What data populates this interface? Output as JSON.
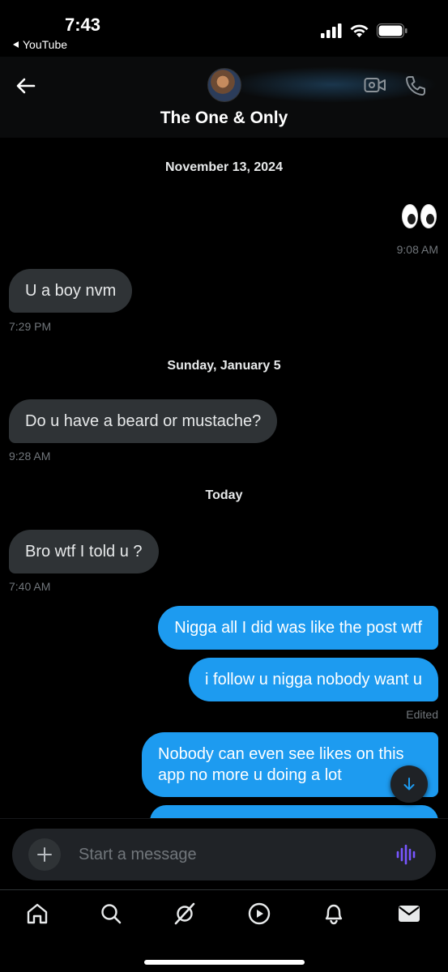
{
  "status_bar": {
    "time": "7:43",
    "back_app": "YouTube"
  },
  "header": {
    "title": "The One & Only"
  },
  "chat": {
    "date_1": "November 13, 2024",
    "emoji_time": "9:08 AM",
    "msg_1": {
      "text": "U a boy nvm",
      "time": "7:29 PM"
    },
    "date_2": "Sunday, January 5",
    "msg_2": {
      "text": "Do u have a beard or mustache?",
      "time": "9:28 AM"
    },
    "date_3": "Today",
    "msg_3": {
      "text": "Bro wtf I told u ?",
      "time": "7:40 AM"
    },
    "out_1": "Nigga all I did was like the post wtf",
    "out_2": "i follow u nigga nobody want u",
    "edited": "Edited",
    "out_3": "Nobody can even see likes on this app no more u doing a lot"
  },
  "compose": {
    "placeholder": "Start a message"
  },
  "colors": {
    "accent": "#1d9bf0",
    "incoming_bubble": "#2f3336",
    "voice_icon": "#7856ff"
  },
  "tabs": [
    "home-icon",
    "search-icon",
    "grok-icon",
    "video-icon",
    "notifications-icon",
    "messages-icon"
  ]
}
